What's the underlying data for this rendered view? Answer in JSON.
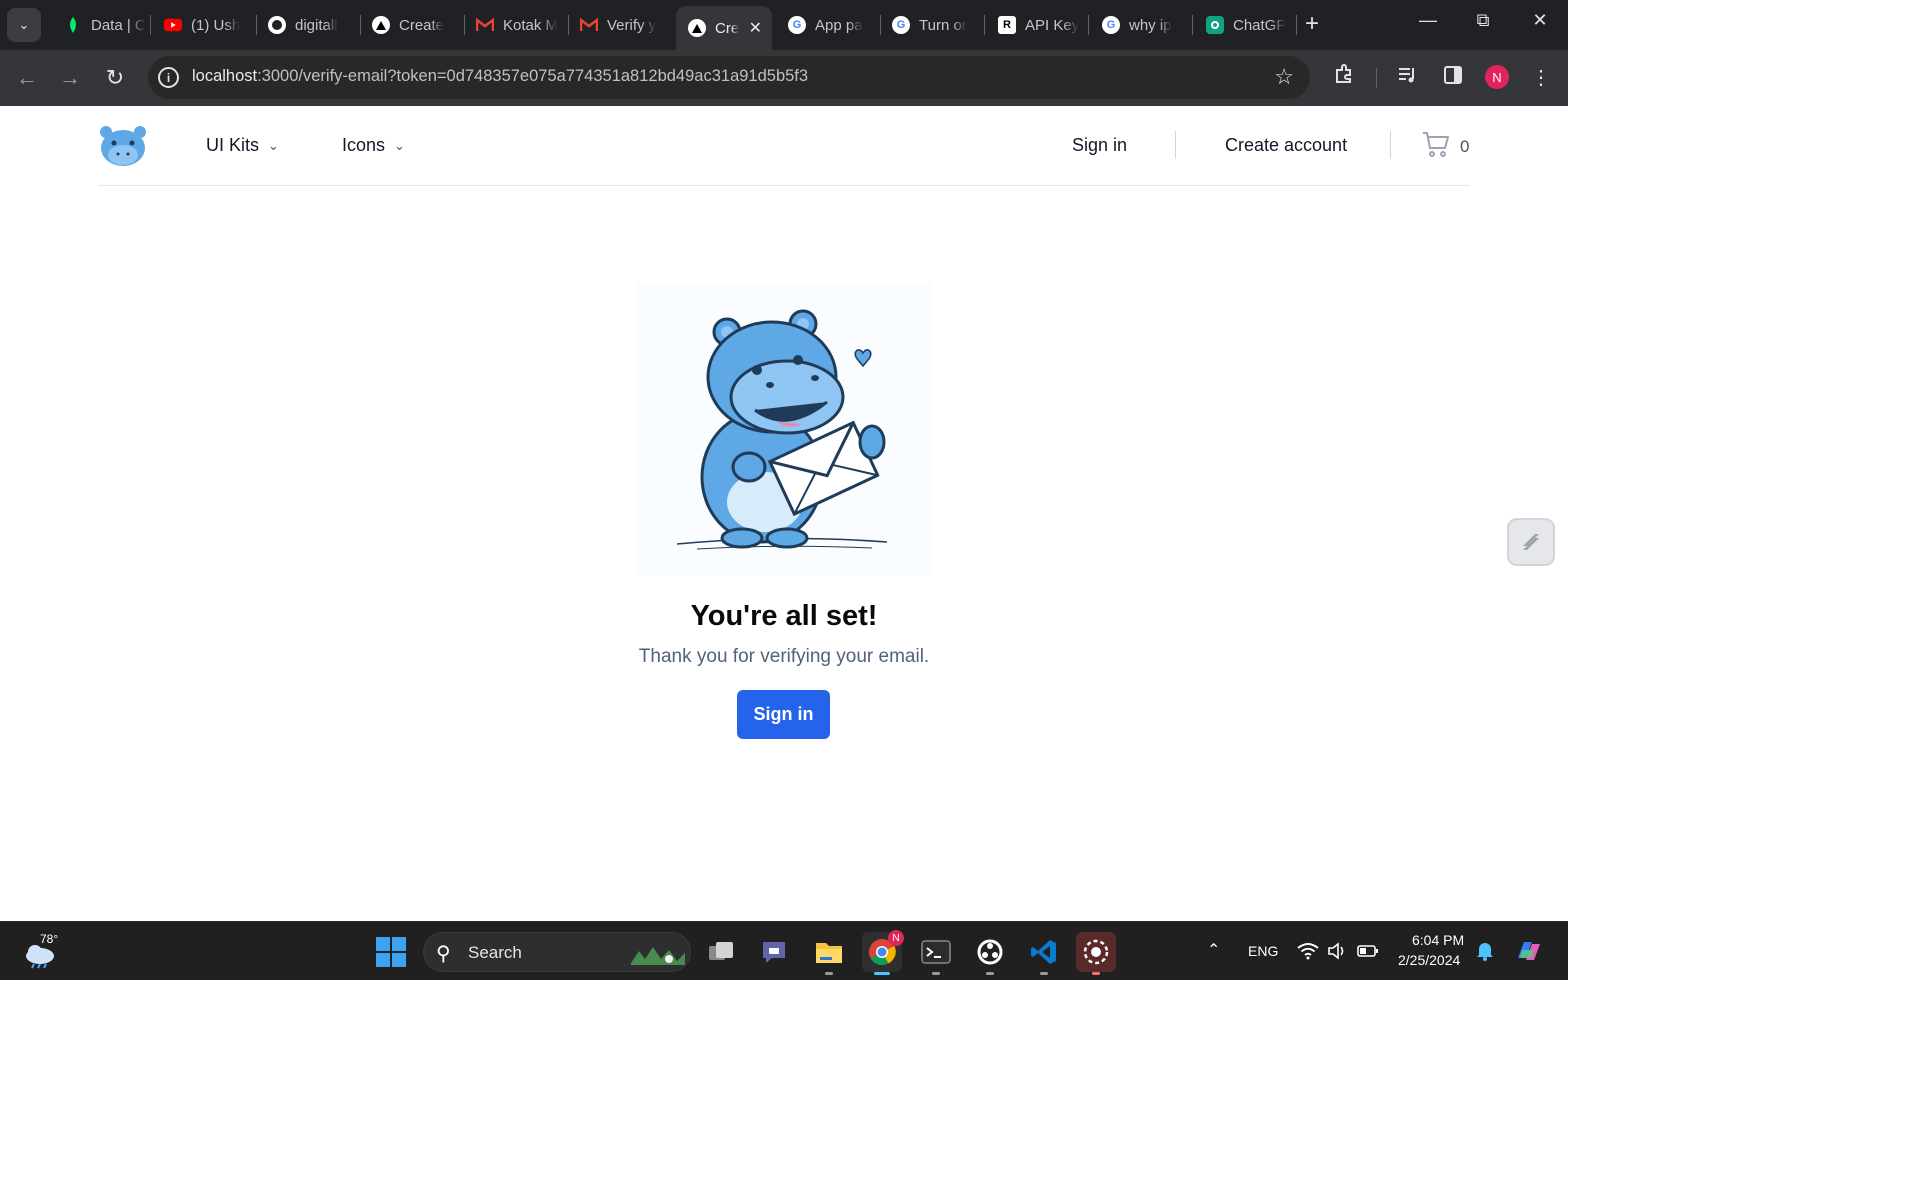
{
  "browser": {
    "tabs": [
      {
        "title": "Data | C",
        "favicon": "leaf-icon"
      },
      {
        "title": "(1) Ush",
        "favicon": "youtube-icon"
      },
      {
        "title": "digitall",
        "favicon": "github-icon"
      },
      {
        "title": "Create",
        "favicon": "vercel-icon"
      },
      {
        "title": "Kotak M",
        "favicon": "gmail-icon"
      },
      {
        "title": "Verify y",
        "favicon": "gmail-icon"
      },
      {
        "title": "Cre",
        "favicon": "vercel-icon",
        "active": true
      },
      {
        "title": "App pa",
        "favicon": "google-icon"
      },
      {
        "title": "Turn or",
        "favicon": "google-icon"
      },
      {
        "title": "API Key",
        "favicon": "r-icon"
      },
      {
        "title": "why ip",
        "favicon": "google-icon"
      },
      {
        "title": "ChatGP",
        "favicon": "chatgpt-icon"
      }
    ],
    "url_host": "localhost",
    "url_rest": ":3000/verify-email?token=0d748357e075a774351a812bd49ac31a91d5b5f3",
    "profile_initial": "N"
  },
  "header": {
    "nav": [
      {
        "label": "UI Kits"
      },
      {
        "label": "Icons"
      }
    ],
    "sign_in_label": "Sign in",
    "create_account_label": "Create account",
    "cart_count": "0"
  },
  "main": {
    "title": "You're all set!",
    "subtitle": "Thank you for verifying your email.",
    "button_label": "Sign in"
  },
  "taskbar": {
    "temperature": "78°",
    "search_label": "Search",
    "language": "ENG",
    "time": "6:04 PM",
    "date": "2/25/2024",
    "chrome_badge": "N"
  },
  "colors": {
    "primary_button": "#2563eb",
    "hippo_blue": "#5fa8e6",
    "browser_frame": "#202124"
  }
}
